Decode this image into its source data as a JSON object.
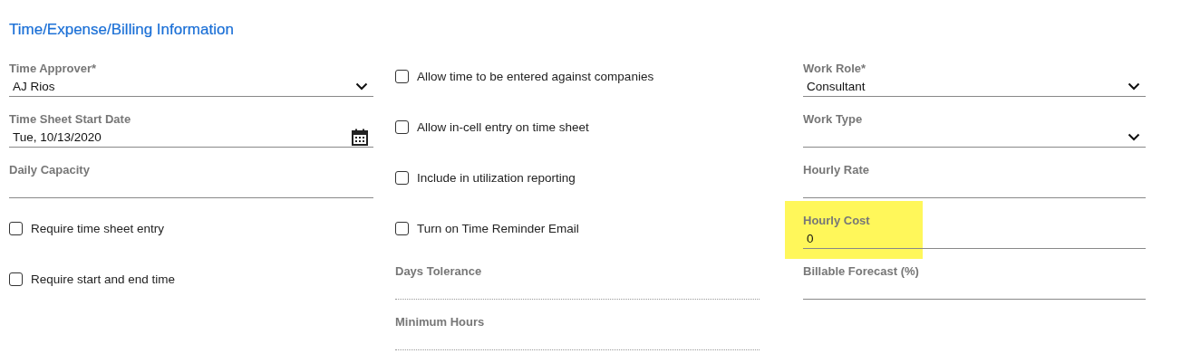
{
  "title": "Time/Expense/Billing Information",
  "columns": [
    {
      "fields": [
        {
          "kind": "select",
          "label": "Time Approver*",
          "value": "AJ Rios"
        },
        {
          "kind": "date",
          "label": "Time Sheet Start Date",
          "value": "Tue, 10/13/2020"
        },
        {
          "kind": "text",
          "label": "Daily Capacity",
          "disabled": false,
          "highlighted": false
        },
        {
          "kind": "checkbox",
          "label": "Require time sheet entry",
          "checked": false
        },
        {
          "kind": "checkbox",
          "label": "Require start and end time",
          "checked": false
        }
      ]
    },
    {
      "fields": [
        {
          "kind": "checkbox",
          "label": "Allow time to be entered against companies",
          "checked": false
        },
        {
          "kind": "checkbox",
          "label": "Allow in-cell entry on time sheet",
          "checked": false
        },
        {
          "kind": "checkbox",
          "label": "Include in utilization reporting",
          "checked": false
        },
        {
          "kind": "checkbox",
          "label": "Turn on Time Reminder Email",
          "checked": false
        },
        {
          "kind": "text",
          "label": "Days Tolerance",
          "disabled": true,
          "highlighted": false
        },
        {
          "kind": "text",
          "label": "Minimum Hours",
          "disabled": true,
          "highlighted": false
        }
      ]
    },
    {
      "fields": [
        {
          "kind": "select",
          "label": "Work Role*",
          "value": "Consultant"
        },
        {
          "kind": "select",
          "label": "Work Type"
        },
        {
          "kind": "text",
          "label": "Hourly Rate",
          "disabled": false,
          "highlighted": false
        },
        {
          "kind": "text",
          "label": "Hourly Cost",
          "value": "0",
          "disabled": false,
          "highlighted": true
        },
        {
          "kind": "text",
          "label": "Billable Forecast (%)",
          "disabled": false,
          "highlighted": false
        }
      ]
    }
  ]
}
